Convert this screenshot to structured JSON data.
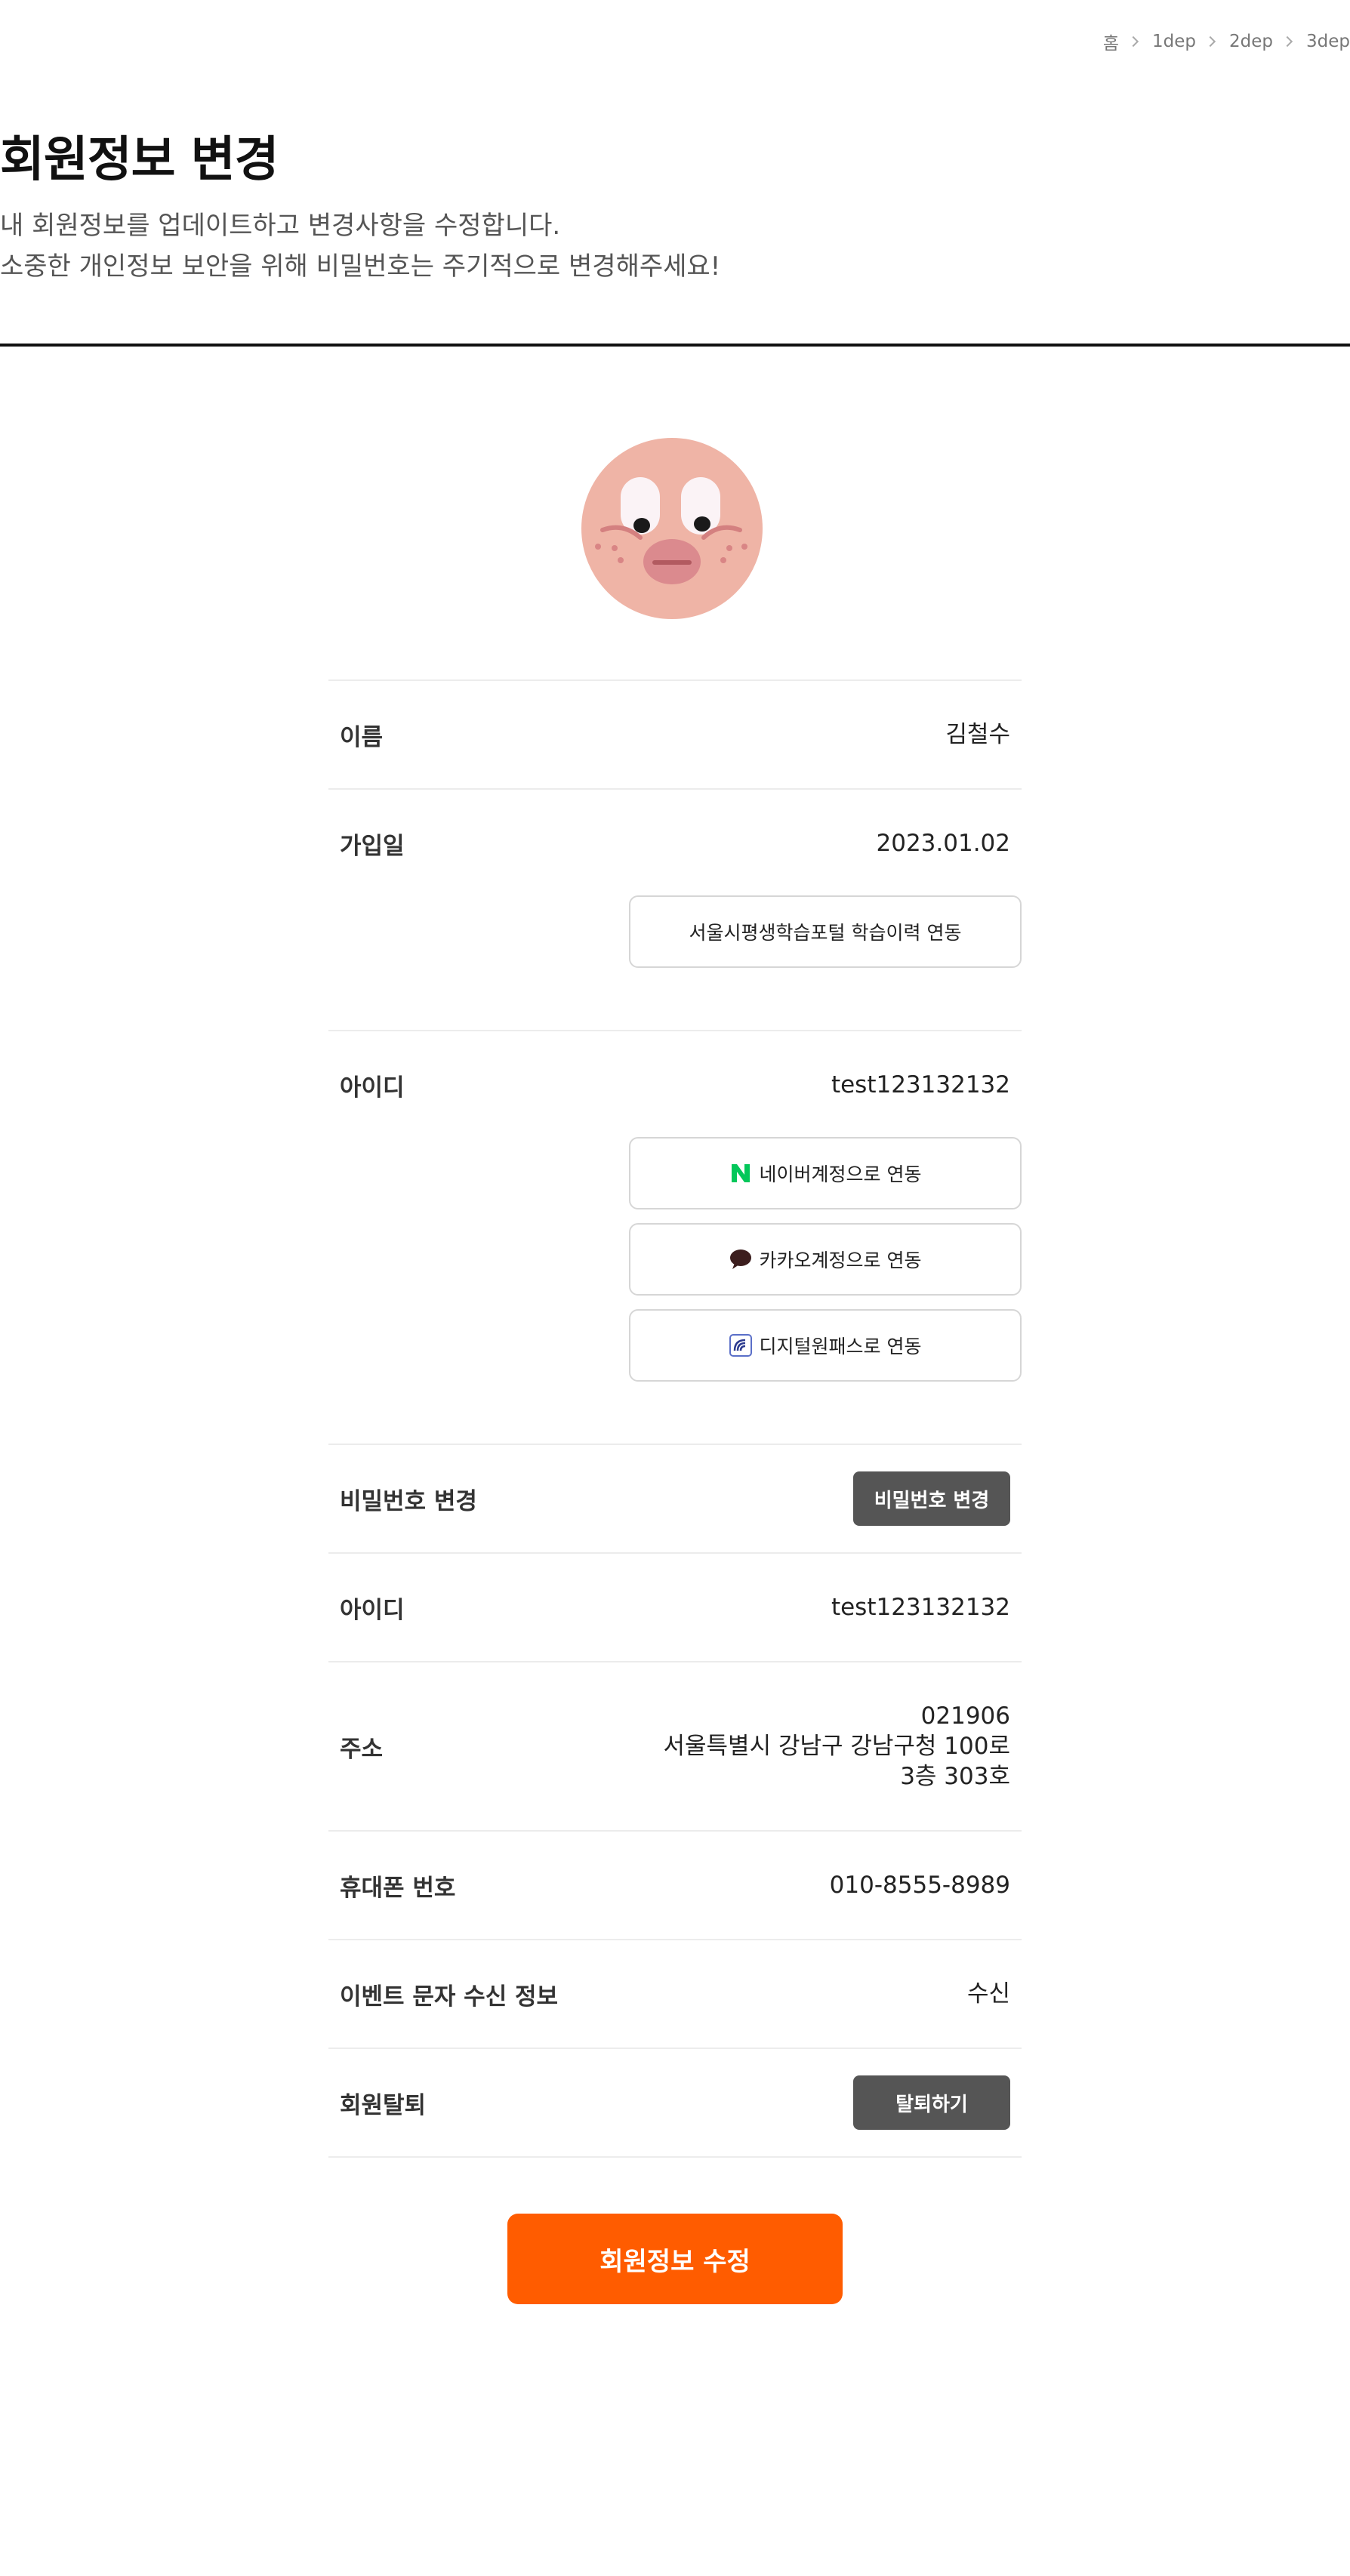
{
  "breadcrumb": {
    "home": "홈",
    "items": [
      "1dep",
      "2dep",
      "3dep"
    ]
  },
  "page": {
    "title": "회원정보 변경",
    "desc_line1": "내 회원정보를 업데이트하고 변경사항을 수정합니다.",
    "desc_line2": "소중한 개인정보 보안을 위해 비밀번호는 주기적으로 변경해주세요!"
  },
  "profile": {
    "name_label": "이름",
    "name_value": "김철수",
    "join_label": "가입일",
    "join_value": "2023.01.02",
    "portal_button": "서울시평생학습포털 학습이력 연동",
    "id_label": "아이디",
    "id_value": "test123132132",
    "naver_button": "네이버계정으로 연동",
    "kakao_button": "카카오계정으로 연동",
    "digital_button": "디지털원패스로 연동",
    "password_label": "비밀번호 변경",
    "password_button": "비밀번호 변경",
    "id2_label": "아이디",
    "id2_value": "test123132132",
    "address_label": "주소",
    "address_zip": "021906",
    "address_line1": "서울특별시 강남구 강남구청 100로",
    "address_line2": "3층 303호",
    "phone_label": "휴대폰 번호",
    "phone_value": "010-8555-8989",
    "sms_label": "이벤트 문자 수신 정보",
    "sms_value": "수신",
    "withdraw_label": "회원탈퇴",
    "withdraw_button": "탈퇴하기"
  },
  "submit_button": "회원정보 수정",
  "colors": {
    "accent": "#ff5c00",
    "dark_button": "#555555",
    "naver": "#03c75a",
    "avatar_bg": "#efb4a6"
  },
  "icons": {
    "naver": "naver-n-icon",
    "kakao": "kakao-talk-icon",
    "digital": "digital-onepass-icon"
  }
}
